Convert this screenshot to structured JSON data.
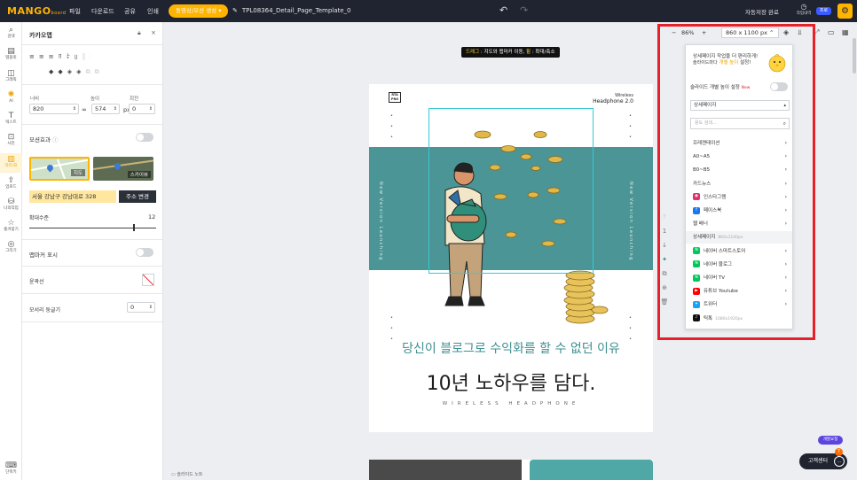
{
  "topbar": {
    "logo": "MANGO",
    "logo_sub": "board",
    "menu": [
      "파일",
      "다운로드",
      "공유",
      "인쇄"
    ],
    "mode_pill": "동영상/모션 생성",
    "doc_name": "TPL08364_Detail_Page_Template_0",
    "autosave": "자동저장 완료",
    "history_label": "작업내역",
    "pro_badge": "프로",
    "colors": {
      "bar": "#1f2430",
      "accent": "#ffb400"
    }
  },
  "iconbar": [
    {
      "icon": "search-icon",
      "label": "검색"
    },
    {
      "icon": "template-icon",
      "label": "템플릿"
    },
    {
      "icon": "graphic-icon",
      "label": "그래픽"
    },
    {
      "icon": "ai-icon",
      "label": "AI"
    },
    {
      "icon": "text-icon",
      "label": "텍스트"
    },
    {
      "icon": "photo-icon",
      "label": "사진"
    },
    {
      "icon": "chart-icon",
      "label": "차트/표",
      "active": true
    },
    {
      "icon": "upload-icon",
      "label": "업로드"
    },
    {
      "icon": "myfolder-icon",
      "label": "나의작업"
    },
    {
      "icon": "star-icon",
      "label": "즐겨찾기"
    },
    {
      "icon": "draw-icon",
      "label": "그리기"
    },
    {
      "icon": "shortcut-icon",
      "label": "단축키"
    }
  ],
  "panel": {
    "title": "카카오맵",
    "width_label": "너비",
    "height_label": "높이",
    "rotate_label": "회전",
    "width": "820",
    "height": "574",
    "unit": "px",
    "rotate": "0",
    "motion_label": "모션효과",
    "map_type_1": "지도",
    "map_type_2": "스카이뷰",
    "address": "서울 강남구 강남대로 328",
    "address_button": "주소 변경",
    "zoom_label": "확대수준",
    "zoom_value": "12",
    "zoom_fraction": 0.82,
    "marker_label": "맵마커 표시",
    "border_label": "윤곽선",
    "radius_label": "모서리 둥글기",
    "radius": "0"
  },
  "canvas": {
    "hint_drag": "드래그",
    "hint_rest": " : 지도와 맵마커 이동, ",
    "hint_wheel": "휠",
    "hint_end": " : 확대/축소",
    "brand": "RTA PRO",
    "wireless": "Wireless",
    "model": "Headphone 2.0",
    "vertical_left": "New Version Launching",
    "vertical_right": "New Version Launching",
    "headline_1": "당신이 블로그로 수익화를 할 수 없던 이유",
    "headline_2": "10년 노하우를 담다.",
    "headline_3": "WIRELESS HEADPHONE",
    "slide_note": "슬라이드 노트",
    "colors": {
      "band": "#4b9596",
      "headline": "#3f8f91"
    }
  },
  "toolbar": {
    "zoom_minus": "−",
    "zoom_value": "86%",
    "zoom_plus": "+",
    "page_size": "860 x 1100 px"
  },
  "popup": {
    "promo_line1": "상세페이지 작업을 더 편리하게!",
    "promo_highlight": "개별 높이",
    "promo_line2": "슬라이드마다",
    "promo_line3": "설정!",
    "slide_height_label": "슬라이드 개별 높이 설정",
    "new_badge": "New",
    "category": "상세페이지",
    "search_placeholder": "용도 검색...",
    "options": [
      {
        "label": "프레젠테이션",
        "arrow": true
      },
      {
        "label": "A0~A5",
        "arrow": true
      },
      {
        "label": "B0~B5",
        "arrow": true
      },
      {
        "label": "카드뉴스",
        "arrow": true
      },
      {
        "label": "인스타그램",
        "arrow": true,
        "badge": "instagram",
        "badge_color": "#e1306c"
      },
      {
        "label": "페이스북",
        "arrow": true,
        "badge": "facebook",
        "badge_color": "#1877f2"
      },
      {
        "label": "웹 배너",
        "arrow": true
      },
      {
        "label": "상세페이지",
        "size": "860x1100px",
        "header": true
      },
      {
        "label": "네이버 스마트스토어",
        "arrow": true,
        "badge": "naver",
        "badge_color": "#03c75a"
      },
      {
        "label": "네이버 블로그",
        "arrow": true,
        "badge": "naver",
        "badge_color": "#03c75a"
      },
      {
        "label": "네이버 TV",
        "arrow": true,
        "badge": "naver",
        "badge_color": "#03c75a"
      },
      {
        "label": "유튜브 Youtube",
        "arrow": true,
        "badge": "youtube",
        "badge_color": "#ff0000"
      },
      {
        "label": "트위터",
        "arrow": true,
        "badge": "twitter",
        "badge_color": "#1da1f2"
      },
      {
        "label": "틱톡",
        "size": "1080x1920px",
        "badge": "tiktok",
        "badge_color": "#111111"
      }
    ]
  },
  "support": {
    "dev_pill": "개발요청",
    "button": "고객센터",
    "count": "7"
  }
}
